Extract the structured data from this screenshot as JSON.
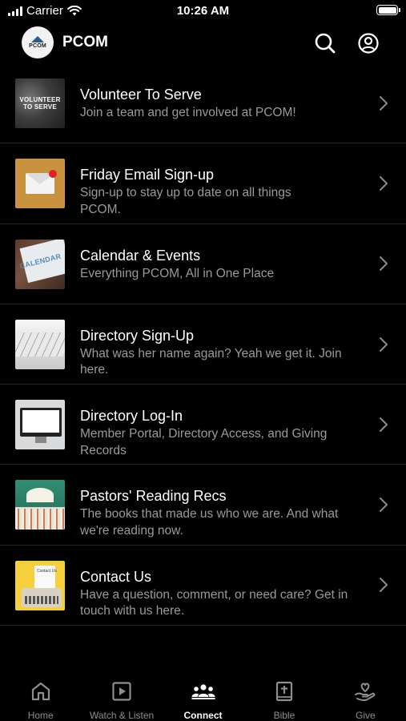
{
  "status_bar": {
    "carrier": "Carrier",
    "time": "10:26 AM"
  },
  "header": {
    "logo_text": "PCOM",
    "title": "PCOM"
  },
  "items": [
    {
      "title": "Volunteer To Serve",
      "subtitle": "Join a team and get involved at PCOM!",
      "thumb_text": "VOLUNTEER TO SERVE"
    },
    {
      "title": "Friday Email Sign-up",
      "subtitle": "Sign-up to stay up to date on all things PCOM."
    },
    {
      "title": "Calendar & Events",
      "subtitle": "Everything PCOM, All in One Place",
      "thumb_text": "CALENDAR"
    },
    {
      "title": "Directory Sign-Up",
      "subtitle": "What was her name again? Yeah we get it. Join here."
    },
    {
      "title": "Directory Log-In",
      "subtitle": "Member Portal, Directory Access, and Giving Records"
    },
    {
      "title": "Pastors' Reading Recs",
      "subtitle": "The books that made us who we are. And what we're reading now."
    },
    {
      "title": "Contact Us",
      "subtitle": "Have a question, comment, or need care? Get in touch with us here.",
      "thumb_text": "Contact Us"
    }
  ],
  "tabs": [
    {
      "label": "Home",
      "icon": "home-icon",
      "active": false
    },
    {
      "label": "Watch & Listen",
      "icon": "play-icon",
      "active": false
    },
    {
      "label": "Connect",
      "icon": "people-icon",
      "active": true
    },
    {
      "label": "Bible",
      "icon": "bible-icon",
      "active": false
    },
    {
      "label": "Give",
      "icon": "give-icon",
      "active": false
    }
  ],
  "colors": {
    "background": "#000000",
    "text": "#ffffff",
    "subtext": "#9a9a9a",
    "tab_inactive": "#8e8e8e",
    "divider": "#262626"
  }
}
